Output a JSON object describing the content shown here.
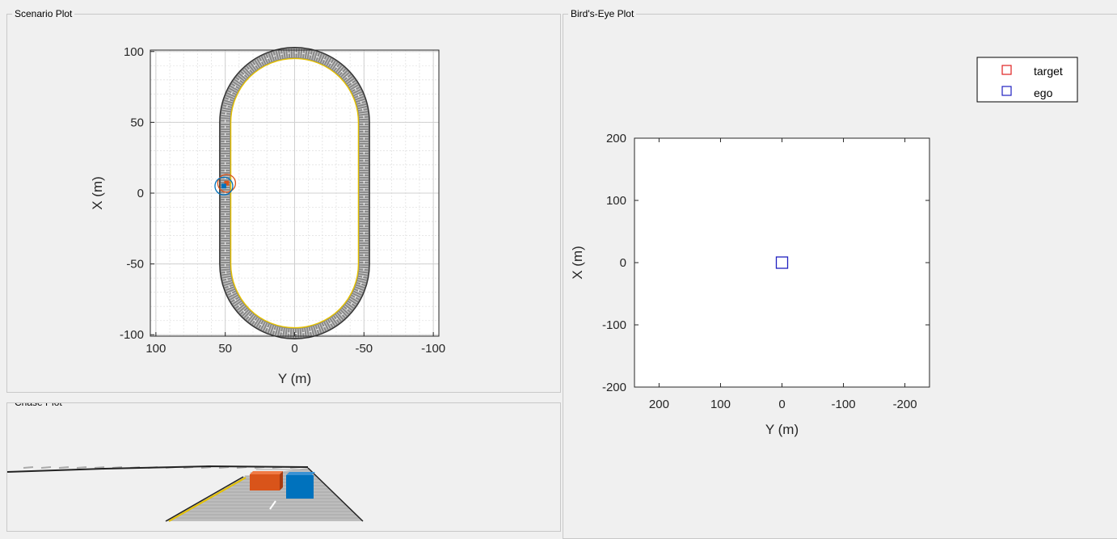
{
  "panels": {
    "scenario": {
      "title": "Scenario Plot"
    },
    "chase": {
      "title": "Chase Plot"
    },
    "birdseye": {
      "title": "Bird's-Eye Plot"
    }
  },
  "scenario_plot": {
    "xlabel": "Y (m)",
    "ylabel": "X (m)",
    "xticks": [
      "100",
      "50",
      "0",
      "-50",
      "-100"
    ],
    "yticks": [
      "100",
      "50",
      "0",
      "-50",
      "-100"
    ],
    "xlim": [
      104,
      -104
    ],
    "ylim": [
      -101,
      101
    ],
    "grid": true,
    "road": {
      "type": "oval track",
      "straight_x_extent": [
        -50,
        50
      ],
      "inner_radius": 46,
      "outer_radius": 54
    },
    "actors": [
      {
        "name": "target",
        "x": 7,
        "y": 49,
        "color": "#d9541a"
      },
      {
        "name": "ego",
        "x": 5,
        "y": 51,
        "color": "#0072bd"
      }
    ]
  },
  "birdseye_plot": {
    "xlabel": "Y (m)",
    "ylabel": "X (m)",
    "xticks": [
      "200",
      "100",
      "0",
      "-100",
      "-200"
    ],
    "yticks": [
      "200",
      "100",
      "0",
      "-100",
      "-200"
    ],
    "xlim": [
      240,
      -240
    ],
    "ylim": [
      -200,
      200
    ],
    "legend": [
      {
        "label": "target",
        "color": "#e02020"
      },
      {
        "label": "ego",
        "color": "#2020c0"
      }
    ],
    "ego_marker": {
      "x": 0,
      "y": 0,
      "color": "#2020c0"
    },
    "legend_placement": "top-right"
  },
  "chase_plot": {
    "target_color": "#d9541a",
    "ego_color": "#0072bd"
  }
}
